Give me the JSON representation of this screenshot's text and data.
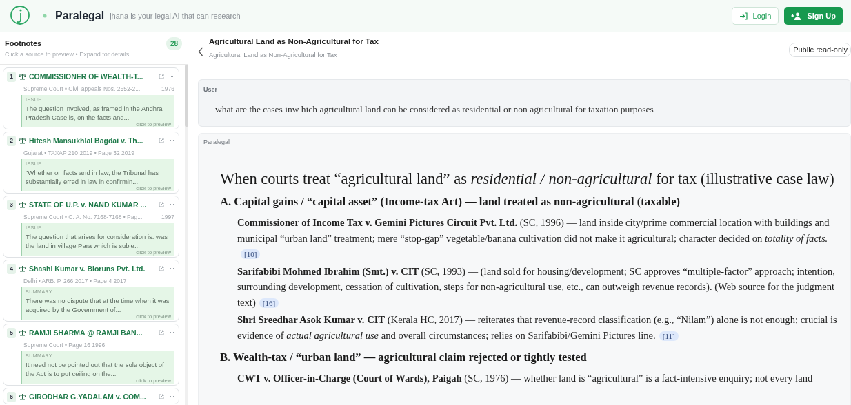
{
  "header": {
    "brand": "Paralegal",
    "tagline": "jhana is your legal AI that can research",
    "buttons": [
      {
        "kind": "login",
        "label": "Login"
      },
      {
        "kind": "signup",
        "label": "Sign Up"
      }
    ]
  },
  "sidebar": {
    "title": "Footnotes",
    "count": "28",
    "hint": "Click a source to preview • Expand for details",
    "footnotes": [
      {
        "number": "1",
        "title": "COMMISSIONER OF WEALTH-T...",
        "meta": "Supreme Court • Civil appeals Nos. 2552-2...",
        "year": "1976",
        "section": "ISSUE",
        "excerpt": "The question involved, as framed in the Andhra Pradesh Case is, on the facts and...",
        "preview_hint": "click to preview"
      },
      {
        "number": "2",
        "title": "Hitesh Mansukhlal Bagdai v. Th...",
        "meta": "Gujarat • TAXAP 210 2019 • Page 32 2019",
        "section": "ISSUE",
        "excerpt": "\"Whether on facts and in law, the Tribunal has substantially erred in law in confirmin...",
        "preview_hint": "click to preview"
      },
      {
        "number": "3",
        "title": "STATE OF U.P. v. NAND KUMAR ...",
        "meta": "Supreme Court • C. A. No. 7168-7168 • Pag...",
        "year": "1997",
        "section": "ISSUE",
        "excerpt": "The question that arises for consideration is: was the land in village Para which is subje...",
        "preview_hint": "click to preview"
      },
      {
        "number": "4",
        "title": "Shashi Kumar v. Bioruns Pvt. Ltd.",
        "meta": "Delhi • ARB. P. 266 2017 • Page 4 2017",
        "section": "SUMMARY",
        "excerpt": "There was no dispute that at the time when it was acquired by the Government of...",
        "preview_hint": "click to preview"
      },
      {
        "number": "5",
        "title": "RAMJI SHARMA @ RAMJI BAN...",
        "meta": "Supreme Court • Page 16 1996",
        "section": "SUMMARY",
        "excerpt": "It need not be pointed out that the sole object of the Act is to put ceiling on the...",
        "preview_hint": "click to preview"
      },
      {
        "number": "6",
        "title": "GIRODHAR G.YADALAM v. COM..."
      }
    ]
  },
  "conversation": {
    "title": "Agricultural Land as Non-Agricultural for Tax",
    "subtitle": "Agricultural Land as Non-Agricultural for Tax",
    "visibility": "Public read-only",
    "messages": [
      {
        "kind": "user",
        "author": "User",
        "text": "what are the cases inw hich agricultural land can be considered as residential or non agricultural for taxation purposes"
      },
      {
        "kind": "assistant",
        "author": "Paralegal",
        "heading": "When courts treat “agricultural land” as *residential / non-agricultural* for tax (illustrative case law)",
        "sections": [
          {
            "heading": "A. Capital gains / “capital asset” (Income-tax Act) — land treated as non-agricultural (taxable)",
            "bullets": [
              {
                "text": "**Commissioner of Income Tax v. Gemini Pictures Circuit Pvt. Ltd.** (SC, 1996) — land inside city/prime commercial location with buildings and municipal “urban land” treatment; mere “stop-gap” vegetable/banana cultivation did not make it agricultural; character decided on *totality of facts.*",
                "cite": "[10]"
              },
              {
                "text": "**Sarifabibi Mohmed Ibrahim (Smt.) v. CIT** (SC, 1993) — (land sold for housing/development; SC approves “multiple-factor” approach; intention, surrounding development, cessation of cultivation, steps for non-agricultural use, etc., can outweigh revenue records). (Web source for the judgment text)",
                "cite": "[16]"
              },
              {
                "text": "**Shri Sreedhar Asok Kumar v. CIT** (Kerala HC, 2017) — reiterates that revenue-record classification (e.g., “Nilam”) alone is not enough; crucial is evidence of *actual agricultural use* and overall circumstances; relies on Sarifabibi/Gemini Pictures line.",
                "cite": "[11]"
              }
            ]
          },
          {
            "heading": "B. Wealth-tax / “urban land” — agricultural claim rejected or tightly tested",
            "bullets": [
              {
                "text": "**CWT v. Officer-in-Charge (Court of Wards), Paigah** (SC, 1976) — whether land is “agricultural” is a fact-intensive enquiry; not every land"
              }
            ]
          }
        ]
      }
    ]
  }
}
